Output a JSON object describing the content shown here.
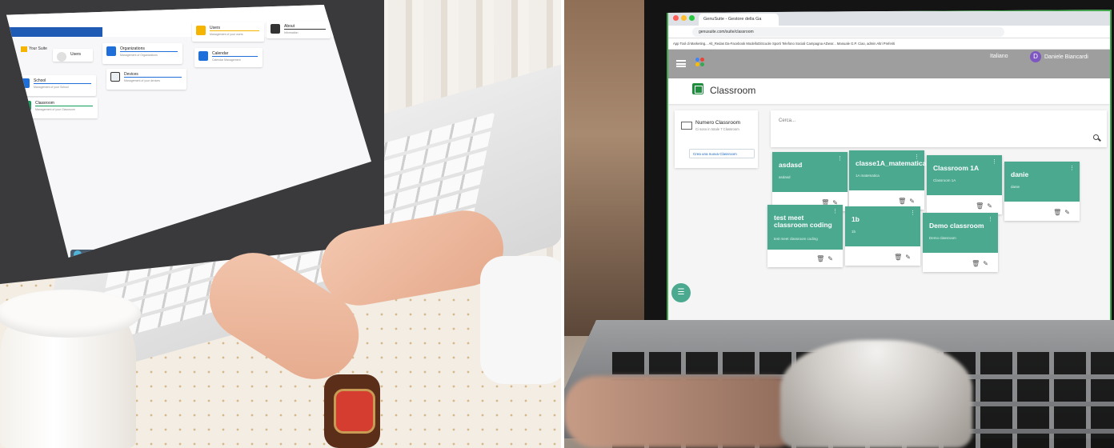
{
  "left_screen": {
    "suite_title": "Your Suite",
    "tiles": [
      {
        "key": "users_small",
        "title": "Users",
        "sub": "FAQ",
        "color": "#888888",
        "icon": "user-icon"
      },
      {
        "key": "organizations",
        "title": "Organizations",
        "sub": "Management of Organizations",
        "color": "#1e6fd9",
        "icon": "org-tree-icon"
      },
      {
        "key": "users",
        "title": "Users",
        "sub": "Management of your users",
        "color": "#f4b400",
        "icon": "users-icon"
      },
      {
        "key": "school",
        "title": "School",
        "sub": "Management of your School",
        "color": "#1e6fd9",
        "icon": "school-icon"
      },
      {
        "key": "devices",
        "title": "Devices",
        "sub": "Management of your devices",
        "color": "#1e6fd9",
        "icon": "devices-icon"
      },
      {
        "key": "calendar",
        "title": "Calendar",
        "sub": "Calendar Management",
        "color": "#1e6fd9",
        "icon": "calendar-icon"
      },
      {
        "key": "about",
        "title": "About",
        "sub": "Information",
        "color": "#333333",
        "icon": "info-icon"
      },
      {
        "key": "classroom",
        "title": "Classroom",
        "sub": "Management of your Classroom",
        "color": "#0f9d58",
        "icon": "classroom-icon"
      }
    ]
  },
  "right_screen": {
    "tab_title": "GenuSuite - Gestore della Ga",
    "url": "genusuite.com/suite/classroom",
    "bookmarks": "App   Tool di Marketing...   Alt_Redas   Da-Facebook   ModelloDiScuole   Sporti   Telefono Sociali   Campagna ADwor...   Manuale G.P.   Ciao, admin   Altri Preferiti",
    "page_title": "Classroom",
    "language": "Italiano",
    "user_initial": "D",
    "user_name": "Daniele Biancardi",
    "side_card": {
      "title": "Numero Classroom",
      "subtitle": "Ci sono in totale 7 Classroom",
      "create_button": "Crea una nuova Classroom"
    },
    "search_placeholder": "Cerca...",
    "classrooms": [
      {
        "name": "asdasd",
        "sub": "asdasd"
      },
      {
        "name": "classe1A_matematica",
        "sub": "1A matematica"
      },
      {
        "name": "Classroom 1A",
        "sub": "Classroom 1A"
      },
      {
        "name": "danie",
        "sub": "danie"
      },
      {
        "name": "test meet classroom coding",
        "sub": "test meet classroom coding"
      },
      {
        "name": "1b",
        "sub": "1b"
      },
      {
        "name": "Demo classroom",
        "sub": "Demo classroom"
      }
    ],
    "card_actions": [
      "trash-icon",
      "edit-icon"
    ],
    "accent": "#4aa98f"
  }
}
